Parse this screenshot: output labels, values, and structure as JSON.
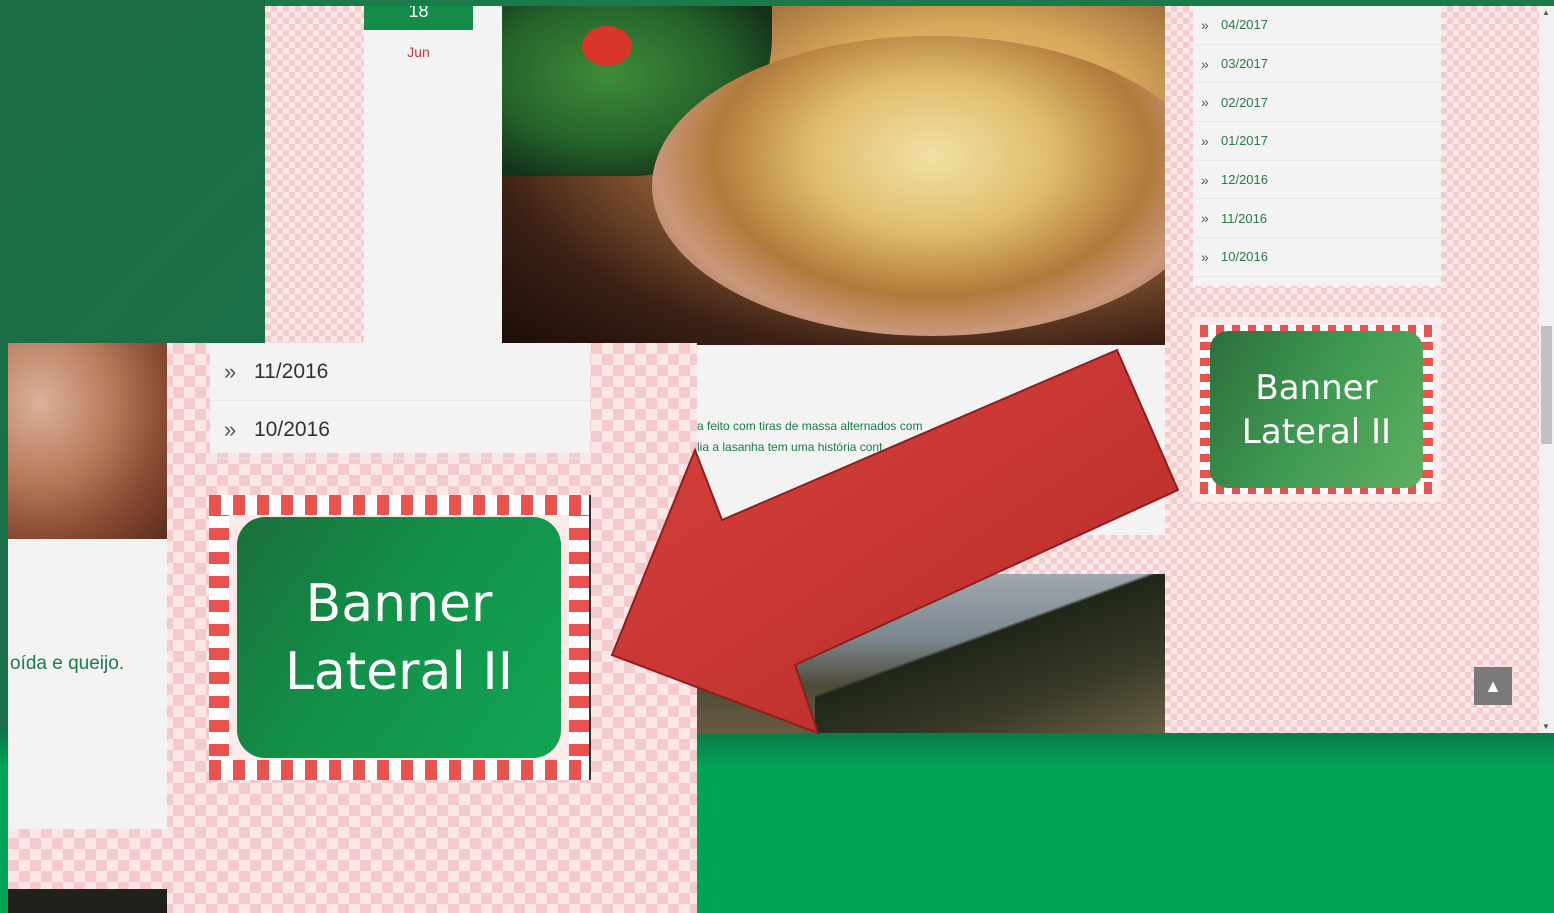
{
  "post": {
    "day": "18",
    "month": "Jun",
    "excerpt_line1": "a feito com tiras de massa alternados com",
    "excerpt_line2": "lia a lasanha tem uma história cont",
    "inset_excerpt": "oída e queijo."
  },
  "archive": {
    "items": [
      {
        "label": "04/2017"
      },
      {
        "label": "03/2017"
      },
      {
        "label": "02/2017"
      },
      {
        "label": "01/2017"
      },
      {
        "label": "12/2016"
      },
      {
        "label": "11/2016"
      },
      {
        "label": "10/2016"
      }
    ],
    "inset_items": [
      {
        "label": "11/2016"
      },
      {
        "label": "10/2016"
      }
    ]
  },
  "banner": {
    "line1": "Banner",
    "line2": "Lateral II"
  },
  "icons": {
    "chevron": "»",
    "scroll_top": "▲",
    "scroll_up": "▲",
    "scroll_down": "▼"
  },
  "colors": {
    "accent_green": "#00a457",
    "date_green": "#128c48",
    "month_red": "#c0343a",
    "arrow_red": "#c9302c"
  }
}
